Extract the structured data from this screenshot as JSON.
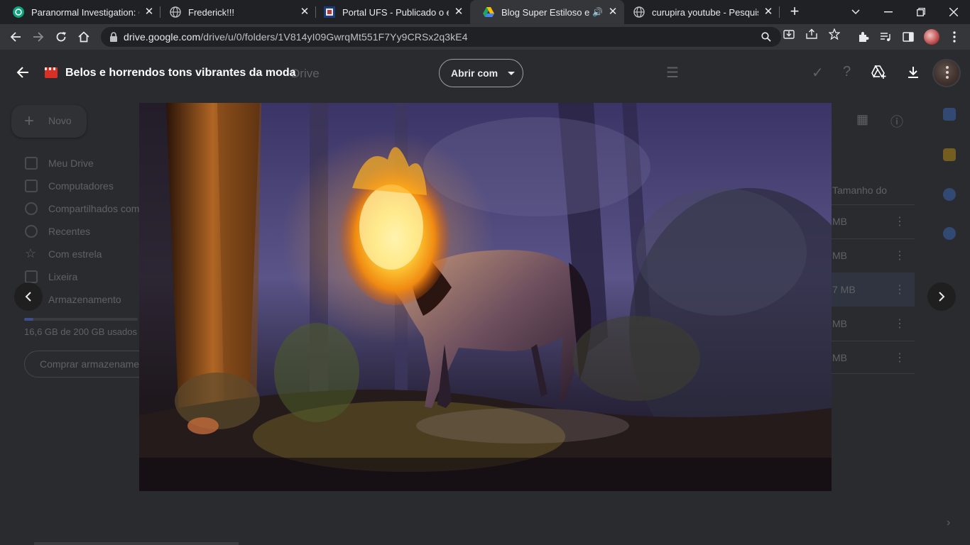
{
  "browser": {
    "tabs": [
      {
        "title": "Paranormal Investigation: Ch",
        "favicon": "chatgpt-icon",
        "active": false
      },
      {
        "title": "Frederick!!!",
        "favicon": "globe-icon",
        "active": false
      },
      {
        "title": "Portal UFS - Publicado o edit",
        "favicon": "ufs-portal-icon",
        "active": false
      },
      {
        "title": "Blog Super Estiloso e nã",
        "favicon": "google-drive-icon",
        "active": true,
        "audio": true
      },
      {
        "title": "curupira youtube - Pesquisa",
        "favicon": "globe-icon",
        "active": false
      }
    ],
    "url_host": "drive.google.com",
    "url_path": "/drive/u/0/folders/1V814yI09GwrqMt551F7Yy9CRSx2q3kE4"
  },
  "viewer": {
    "file_title": "Belos e horrendos tons vibrantes da moda",
    "open_with_label": "Abrir com",
    "image_alt": "Horse with flaming head in a purple misty forest"
  },
  "drive_background": {
    "drive_label": "Drive",
    "new_button": "Novo",
    "nav": [
      "Meu Drive",
      "Computadores",
      "Compartilhados comigo",
      "Recentes",
      "Com estrela",
      "Lixeira",
      "Armazenamento"
    ],
    "storage_text": "16,6 GB de 200 GB usados",
    "storage_fraction": 0.083,
    "buy_storage": "Comprar armazenamento",
    "column_header": "Tamanho do",
    "sizes": [
      "MB",
      "MB",
      "7 MB",
      "MB",
      "MB"
    ]
  },
  "colors": {
    "tab_active_bg": "#35363a",
    "tab_strip_bg": "#202124",
    "file_icon": "#d93025"
  }
}
